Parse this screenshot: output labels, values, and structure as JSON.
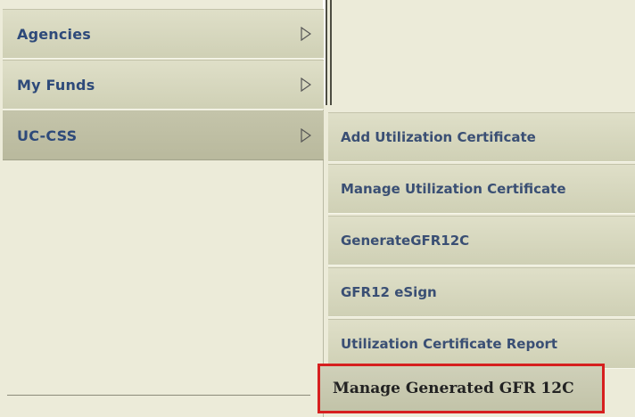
{
  "menu": {
    "items": [
      {
        "label": "Agencies"
      },
      {
        "label": "My Funds"
      },
      {
        "label": "UC-CSS"
      }
    ]
  },
  "submenu": {
    "items": [
      {
        "label": "Add Utilization Certificate"
      },
      {
        "label": "Manage Utilization Certificate"
      },
      {
        "label": "GenerateGFR12C"
      },
      {
        "label": "GFR12 eSign"
      },
      {
        "label": "Utilization Certificate Report"
      },
      {
        "label": "Manage Generated GFR 12C"
      }
    ]
  },
  "colors": {
    "menu_text": "#2e4a7a",
    "highlight_border": "#d61f1f",
    "background": "#ecebd9"
  },
  "icons": {
    "submenu_arrow": "triangle-right-outline"
  }
}
